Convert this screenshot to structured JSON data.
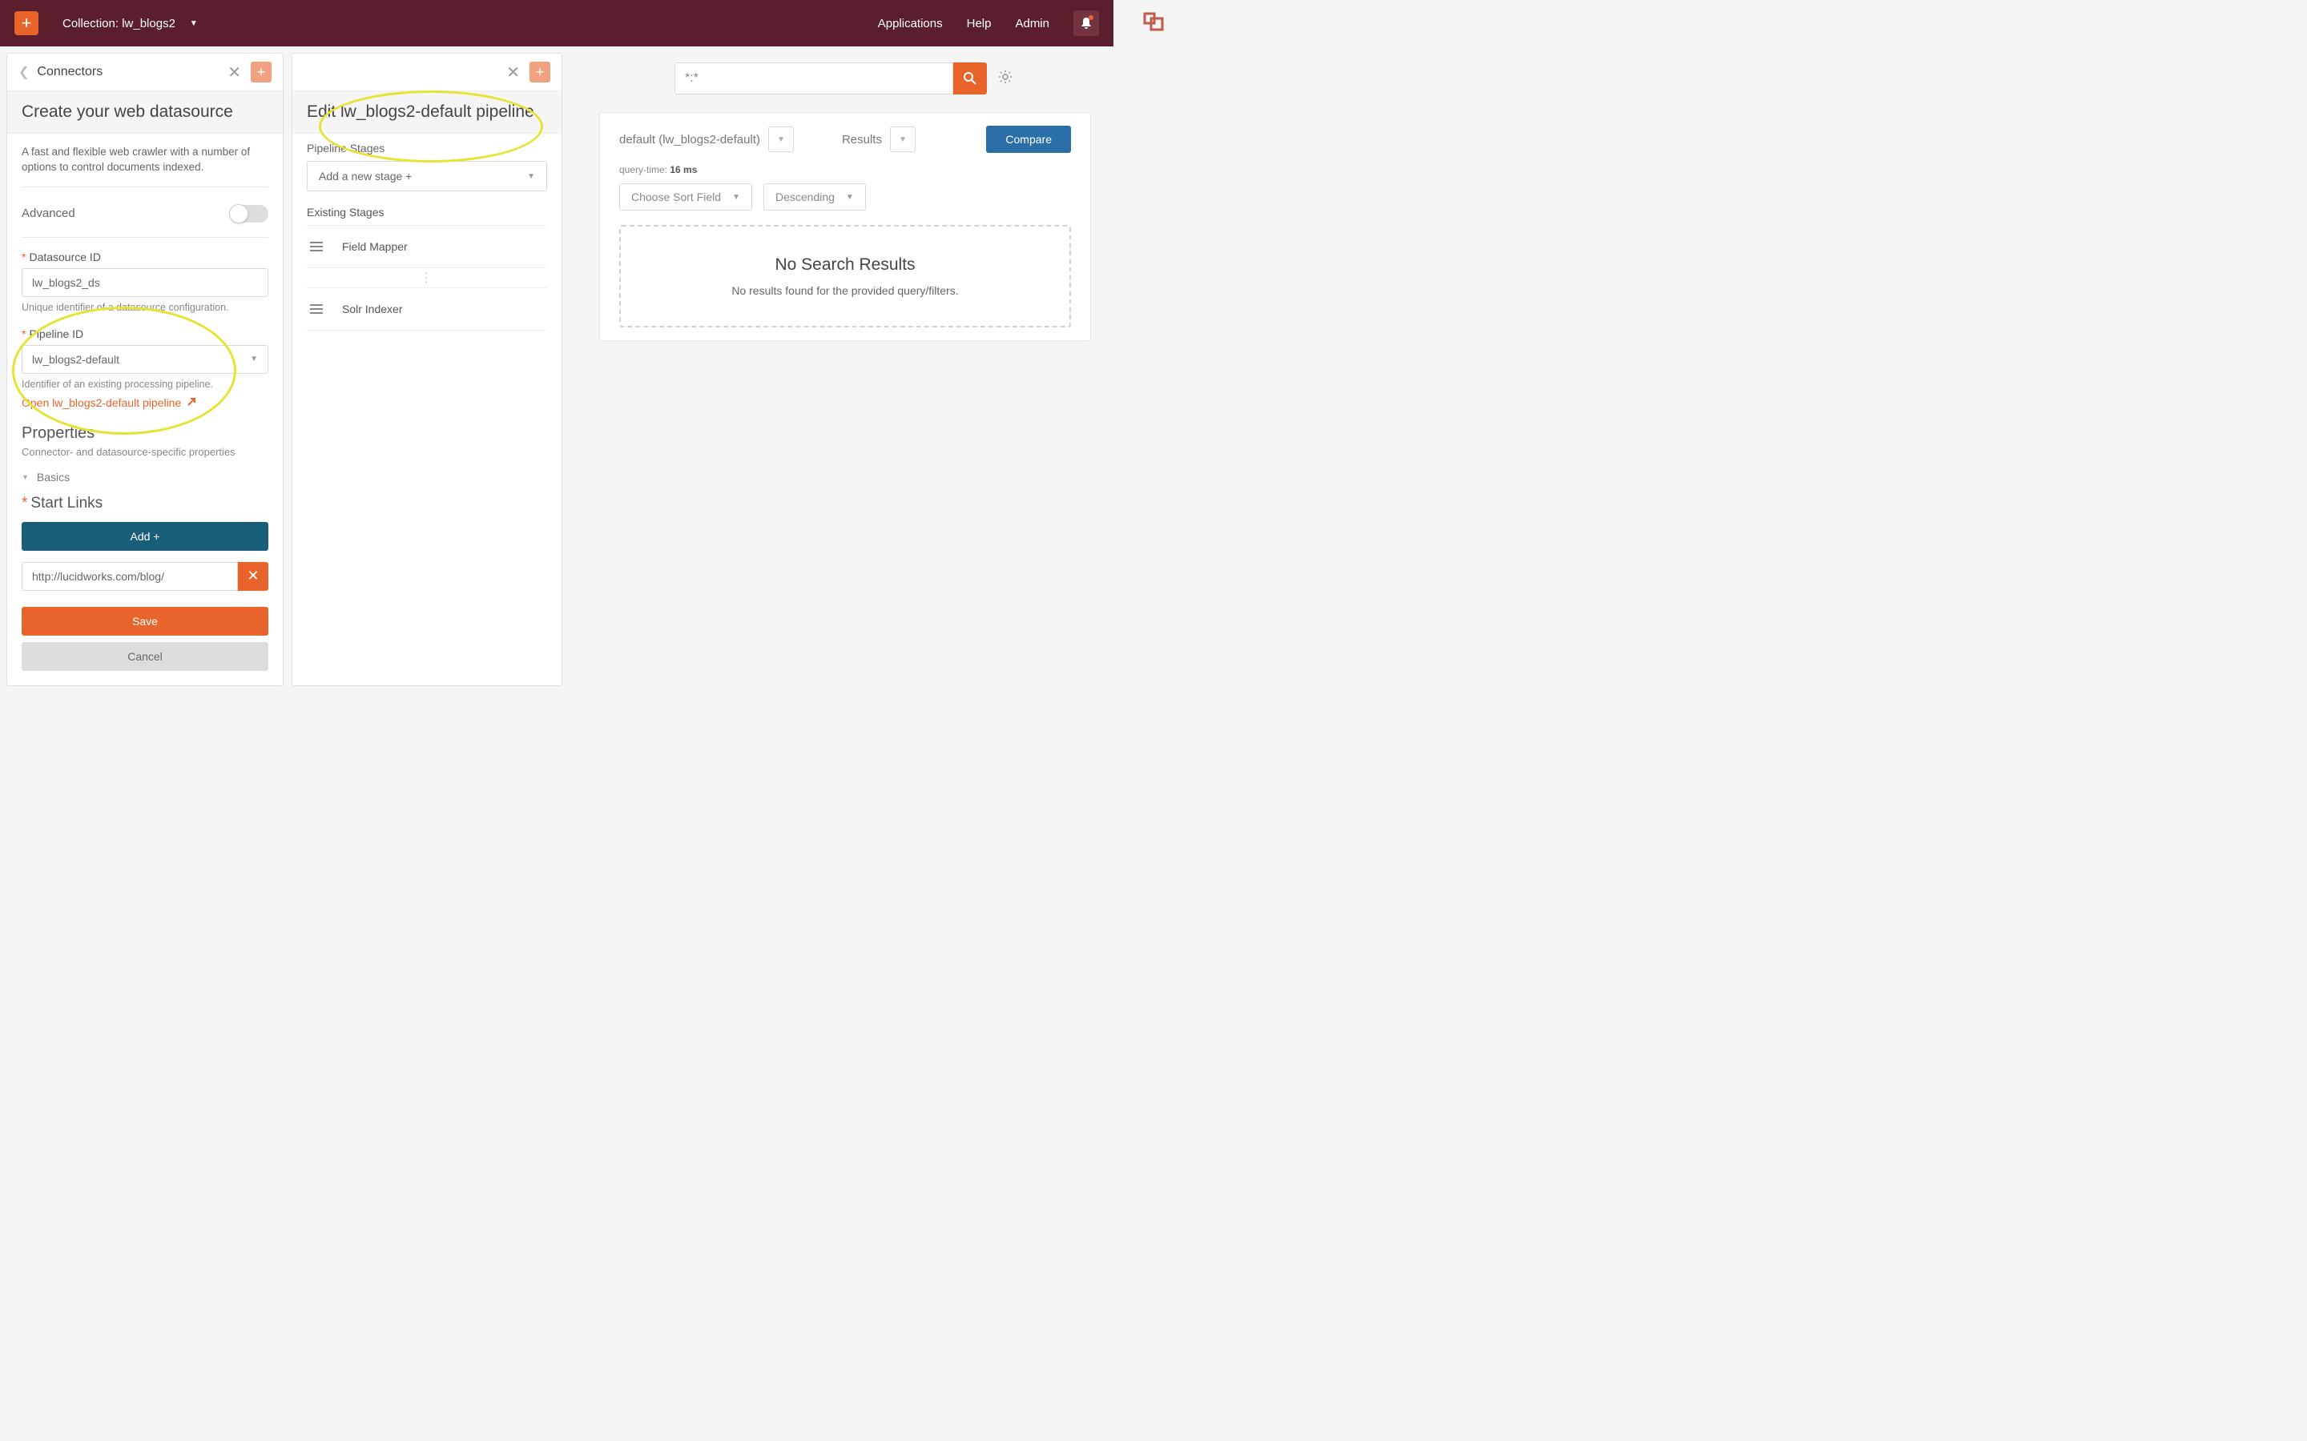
{
  "header": {
    "collection_label": "Collection: lw_blogs2",
    "links": {
      "applications": "Applications",
      "help": "Help",
      "admin": "Admin"
    }
  },
  "left": {
    "breadcrumb": "Connectors",
    "title": "Create your web datasource",
    "desc": "A fast and flexible web crawler with a number of options to control documents indexed.",
    "advanced_label": "Advanced",
    "datasource_id": {
      "label": "Datasource ID",
      "value": "lw_blogs2_ds",
      "hint": "Unique identifier of a datasource configuration."
    },
    "pipeline_id": {
      "label": "Pipeline ID",
      "value": "lw_blogs2-default",
      "hint": "Identifier of an existing processing pipeline.",
      "open_link": "Open lw_blogs2-default pipeline"
    },
    "properties": {
      "title": "Properties",
      "desc": "Connector- and datasource-specific properties"
    },
    "basics_label": "Basics",
    "start_links": {
      "title": "Start Links",
      "add_label": "Add +",
      "value": "http://lucidworks.com/blog/"
    },
    "save": "Save",
    "cancel": "Cancel"
  },
  "mid": {
    "title": "Edit lw_blogs2-default pipeline",
    "stages_label": "Pipeline Stages",
    "add_stage": "Add a new stage +",
    "existing_label": "Existing Stages",
    "stages": [
      "Field Mapper",
      "Solr Indexer"
    ]
  },
  "right": {
    "search_value": "*:*",
    "default_label": "default (lw_blogs2-default)",
    "results_label": "Results",
    "compare": "Compare",
    "query_time_prefix": "query-time: ",
    "query_time_value": "16 ms",
    "sort_field": "Choose Sort Field",
    "sort_dir": "Descending",
    "no_results_title": "No Search Results",
    "no_results_sub": "No results found for the provided query/filters."
  }
}
